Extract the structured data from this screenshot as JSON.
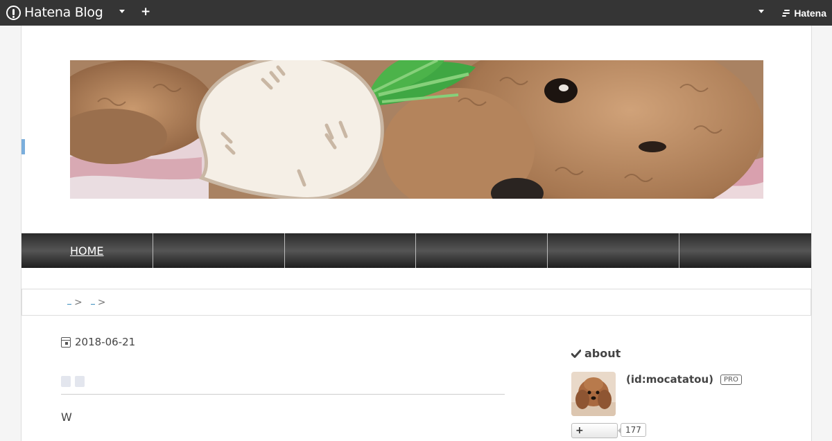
{
  "global_bar": {
    "logo_text": "Hatena Blog",
    "add_label": "+",
    "brand_text": "Hatena"
  },
  "nav": {
    "items": [
      {
        "label": "HOME"
      },
      {
        "label": ""
      },
      {
        "label": ""
      },
      {
        "label": ""
      },
      {
        "label": ""
      },
      {
        "label": ""
      }
    ]
  },
  "breadcrumb": {
    "separator": ">"
  },
  "entry": {
    "date": "2018-06-21",
    "body_text": "W"
  },
  "sidebar": {
    "about_heading": "about",
    "profile_id": "(id:mocatatou)",
    "pro_badge": "PRO",
    "follow_label": "+",
    "follower_count": "177"
  },
  "colors": {
    "global_bar_bg": "#353535",
    "accent_blue": "#7aaedc",
    "link_blue": "#3b8dbd"
  }
}
